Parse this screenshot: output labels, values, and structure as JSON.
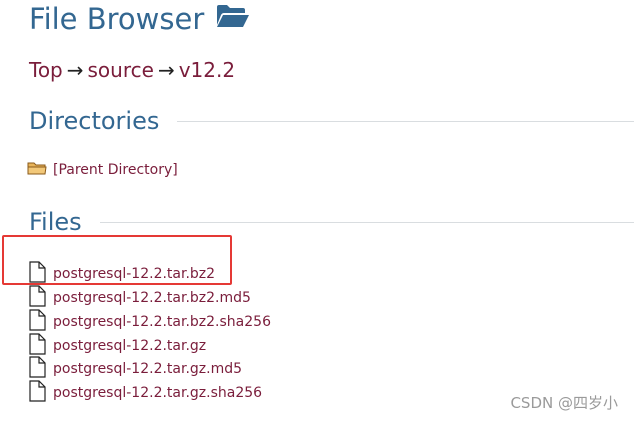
{
  "header": {
    "title": "File Browser",
    "title_icon": "folder-open-icon"
  },
  "breadcrumb": {
    "items": [
      "Top",
      "source",
      "v12.2"
    ],
    "separator": "→"
  },
  "directories": {
    "heading": "Directories",
    "items": [
      {
        "label": "[Parent Directory]",
        "icon": "folder-icon"
      }
    ]
  },
  "files": {
    "heading": "Files",
    "items": [
      {
        "label": "postgresql-12.2.tar.bz2",
        "icon": "file-icon",
        "highlighted": true
      },
      {
        "label": "postgresql-12.2.tar.bz2.md5",
        "icon": "file-icon"
      },
      {
        "label": "postgresql-12.2.tar.bz2.sha256",
        "icon": "file-icon"
      },
      {
        "label": "postgresql-12.2.tar.gz",
        "icon": "file-icon"
      },
      {
        "label": "postgresql-12.2.tar.gz.md5",
        "icon": "file-icon"
      },
      {
        "label": "postgresql-12.2.tar.gz.sha256",
        "icon": "file-icon"
      }
    ]
  },
  "watermark": "CSDN @四岁小",
  "colors": {
    "heading": "#336791",
    "link": "#7a1d3b",
    "highlight_border": "#e53935",
    "rule": "#d9dde0"
  }
}
